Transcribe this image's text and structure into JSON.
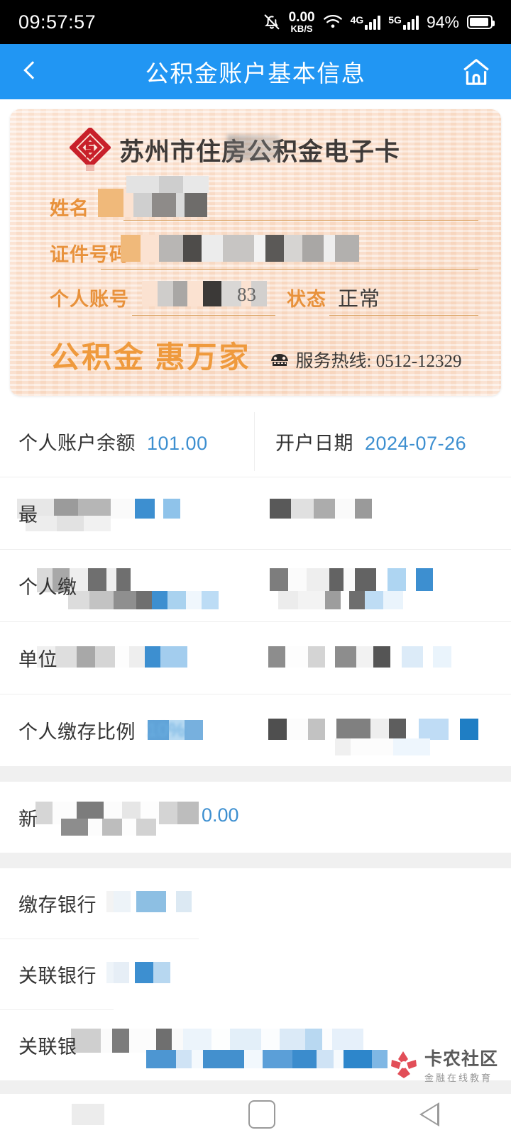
{
  "status_bar": {
    "time": "09:57:57",
    "notification_icon": "bell-off-icon",
    "net_speed_value": "0.00",
    "net_speed_unit": "KB/S",
    "wifi_icon": "wifi-icon",
    "sim1_label": "4G",
    "sim2_label": "5G",
    "battery_percent": "94%",
    "battery_icon": "battery-icon"
  },
  "header": {
    "back_icon": "chevron-left-icon",
    "title": "公积金账户基本信息",
    "home_icon": "home-icon",
    "accent_color": "#2196f3"
  },
  "card": {
    "logo_icon": "housing-fund-logo-icon",
    "title": "苏州市住房公积金电子卡",
    "fields": [
      {
        "label": "姓名",
        "value": "",
        "masked": true
      },
      {
        "label": "证件号码",
        "value": "",
        "masked": true
      },
      {
        "label": "个人账号",
        "value": "83",
        "masked": true
      },
      {
        "label": "状态",
        "value": "正常",
        "masked": false
      }
    ],
    "slogan": "公积金  惠万家",
    "phone_icon": "telephone-icon",
    "hotline_label": "服务热线: 0512-12329",
    "label_color": "#e8923c",
    "bg_color": "#fbe2d1"
  },
  "info": {
    "section1": {
      "balance": {
        "label": "个人账户余额",
        "value": "101.00"
      },
      "open_date": {
        "label": "开户日期",
        "value": "2024-07-26"
      },
      "rows": [
        {
          "label": "最",
          "value": "",
          "masked": true
        },
        {
          "label": "个人缴",
          "value": "",
          "masked": true
        },
        {
          "label": "单位",
          "value": "",
          "masked": true
        },
        {
          "label": "个人缴存比例",
          "value": "10%",
          "masked": true
        }
      ]
    },
    "section2": {
      "rows": [
        {
          "label": "新",
          "value": "0.00",
          "masked": true
        }
      ]
    },
    "section3": {
      "rows": [
        {
          "label": "缴存银行",
          "value": "",
          "masked": true
        },
        {
          "label": "关联银行",
          "value": "",
          "masked": true
        },
        {
          "label": "关联银",
          "value": "",
          "masked": true
        }
      ]
    },
    "value_color": "#3d8fd0"
  },
  "watermark": {
    "logo_icon": "kanong-logo-icon",
    "title": "卡农社区",
    "subtitle": "金融在线教育",
    "color": "#e0404a"
  },
  "navbar": {
    "recents_icon": "recents-icon",
    "home_icon": "home-square-icon",
    "back_icon": "back-triangle-icon"
  }
}
